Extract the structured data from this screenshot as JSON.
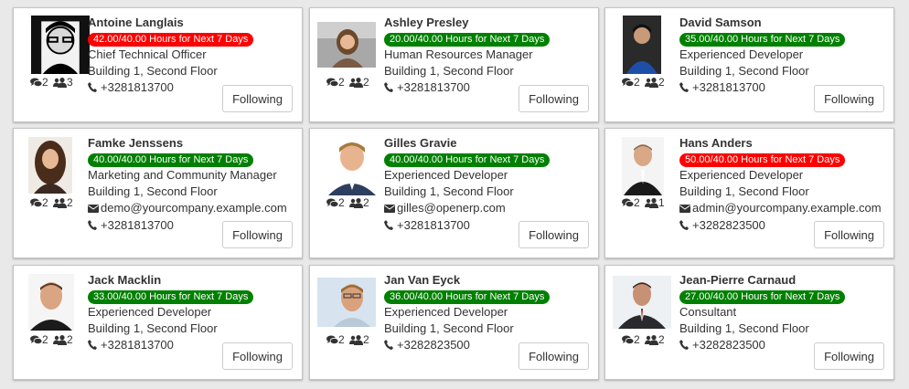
{
  "follow_label": "Following",
  "colors": {
    "over": "#ff0000",
    "ok": "#008000"
  },
  "employees": [
    {
      "name": "Antoine Langlais",
      "hours": "42.00/40.00 Hours for Next 7 Days",
      "status": "over",
      "job": "Chief Technical Officer",
      "location": "Building 1, Second Floor",
      "email": "",
      "phone": "+3281813700",
      "messages": "2",
      "followers": "3"
    },
    {
      "name": "Ashley Presley",
      "hours": "20.00/40.00 Hours for Next 7 Days",
      "status": "ok",
      "job": "Human Resources Manager",
      "location": "Building 1, Second Floor",
      "email": "",
      "phone": "+3281813700",
      "messages": "2",
      "followers": "2"
    },
    {
      "name": "David Samson",
      "hours": "35.00/40.00 Hours for Next 7 Days",
      "status": "ok",
      "job": "Experienced Developer",
      "location": "Building 1, Second Floor",
      "email": "",
      "phone": "+3281813700",
      "messages": "2",
      "followers": "2"
    },
    {
      "name": "Famke Jenssens",
      "hours": "40.00/40.00 Hours for Next 7 Days",
      "status": "ok",
      "job": "Marketing and Community Manager",
      "location": "Building 1, Second Floor",
      "email": "demo@yourcompany.example.com",
      "phone": "+3281813700",
      "messages": "2",
      "followers": "2"
    },
    {
      "name": "Gilles Gravie",
      "hours": "40.00/40.00 Hours for Next 7 Days",
      "status": "ok",
      "job": "Experienced Developer",
      "location": "Building 1, Second Floor",
      "email": "gilles@openerp.com",
      "phone": "+3281813700",
      "messages": "2",
      "followers": "2"
    },
    {
      "name": "Hans Anders",
      "hours": "50.00/40.00 Hours for Next 7 Days",
      "status": "over",
      "job": "Experienced Developer",
      "location": "Building 1, Second Floor",
      "email": "admin@yourcompany.example.com",
      "phone": "+3282823500",
      "messages": "2",
      "followers": "1"
    },
    {
      "name": "Jack Macklin",
      "hours": "33.00/40.00 Hours for Next 7 Days",
      "status": "ok",
      "job": "Experienced Developer",
      "location": "Building 1, Second Floor",
      "email": "",
      "phone": "+3281813700",
      "messages": "2",
      "followers": "2"
    },
    {
      "name": "Jan Van Eyck",
      "hours": "36.00/40.00 Hours for Next 7 Days",
      "status": "ok",
      "job": "Experienced Developer",
      "location": "Building 1, Second Floor",
      "email": "",
      "phone": "+3282823500",
      "messages": "2",
      "followers": "2"
    },
    {
      "name": "Jean-Pierre Carnaud",
      "hours": "27.00/40.00 Hours for Next 7 Days",
      "status": "ok",
      "job": "Consultant",
      "location": "Building 1, Second Floor",
      "email": "",
      "phone": "+3282823500",
      "messages": "2",
      "followers": "2"
    }
  ]
}
